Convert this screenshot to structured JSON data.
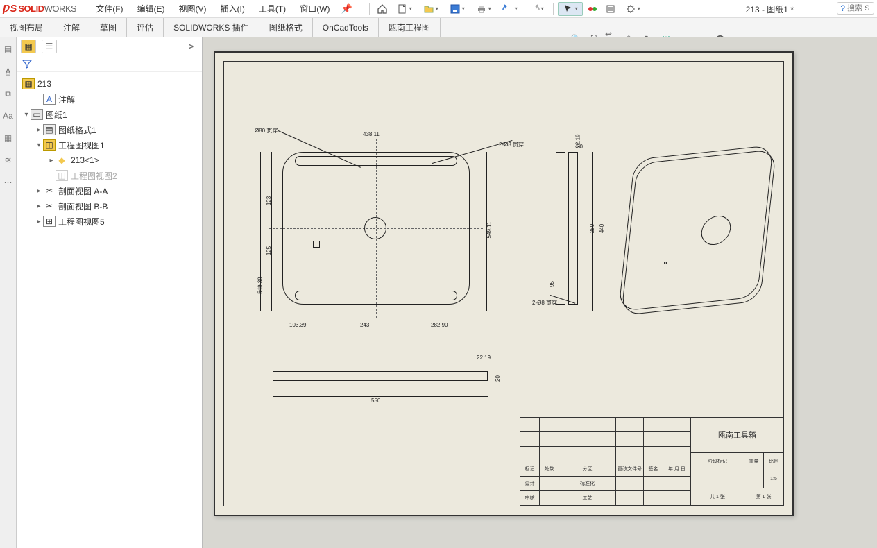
{
  "app": {
    "brand1": "SOLID",
    "brand2": "WORKS",
    "doc_title": "213 - 图纸1 *"
  },
  "menu": {
    "file": "文件(F)",
    "edit": "编辑(E)",
    "view": "视图(V)",
    "insert": "插入(I)",
    "tools": "工具(T)",
    "window": "窗口(W)"
  },
  "search": {
    "placeholder": "搜索 S"
  },
  "ribbon": {
    "t1": "视图布局",
    "t2": "注解",
    "t3": "草图",
    "t4": "评估",
    "t5": "SOLIDWORKS 插件",
    "t6": "图纸格式",
    "t7": "OnCadTools",
    "t8": "瓯南工程图"
  },
  "tree": {
    "root": "213",
    "annotations": "注解",
    "sheet": "图纸1",
    "format": "图纸格式1",
    "view1": "工程图视图1",
    "part": "213<1>",
    "view2": "工程图视图2",
    "sectionAA": "剖面视图 A-A",
    "sectionBB": "剖面视图 B-B",
    "view5": "工程图视图5"
  },
  "dims": {
    "phi_note": "Ø80 贯穿",
    "top_width": "438.11",
    "right_note": "2-Ø8 贯穿",
    "right_height": "549.11",
    "left_seg1": "123",
    "left_seg2": "125",
    "left_total": "549.39",
    "bot_seg1": "103.39",
    "bot_seg2": "243",
    "bot_seg3": "282.90",
    "side_top": "22.19",
    "side_gap": "20",
    "side_h1": "250",
    "side_h2": "440",
    "side_b": "95",
    "side_note": "2-Ø8 贯穿",
    "bview_t": "22.19",
    "bview_h": "20",
    "bview_w": "550"
  },
  "titleblock": {
    "company": "瓯南工具箱",
    "hdr_mark": "标记",
    "hdr_zone": "处数",
    "hdr_div": "分区",
    "hdr_file": "更改文件号",
    "hdr_sign": "签名",
    "hdr_date": "年.月.日",
    "row_design": "设计",
    "row_std": "标准化",
    "row_check": "审核",
    "row_proc": "工艺",
    "stage": "阶段标记",
    "weight": "重量",
    "scale": "比例",
    "scale_val": "1:5",
    "sheet_lbl": "共 1 张",
    "page_lbl": "第 1 张"
  }
}
